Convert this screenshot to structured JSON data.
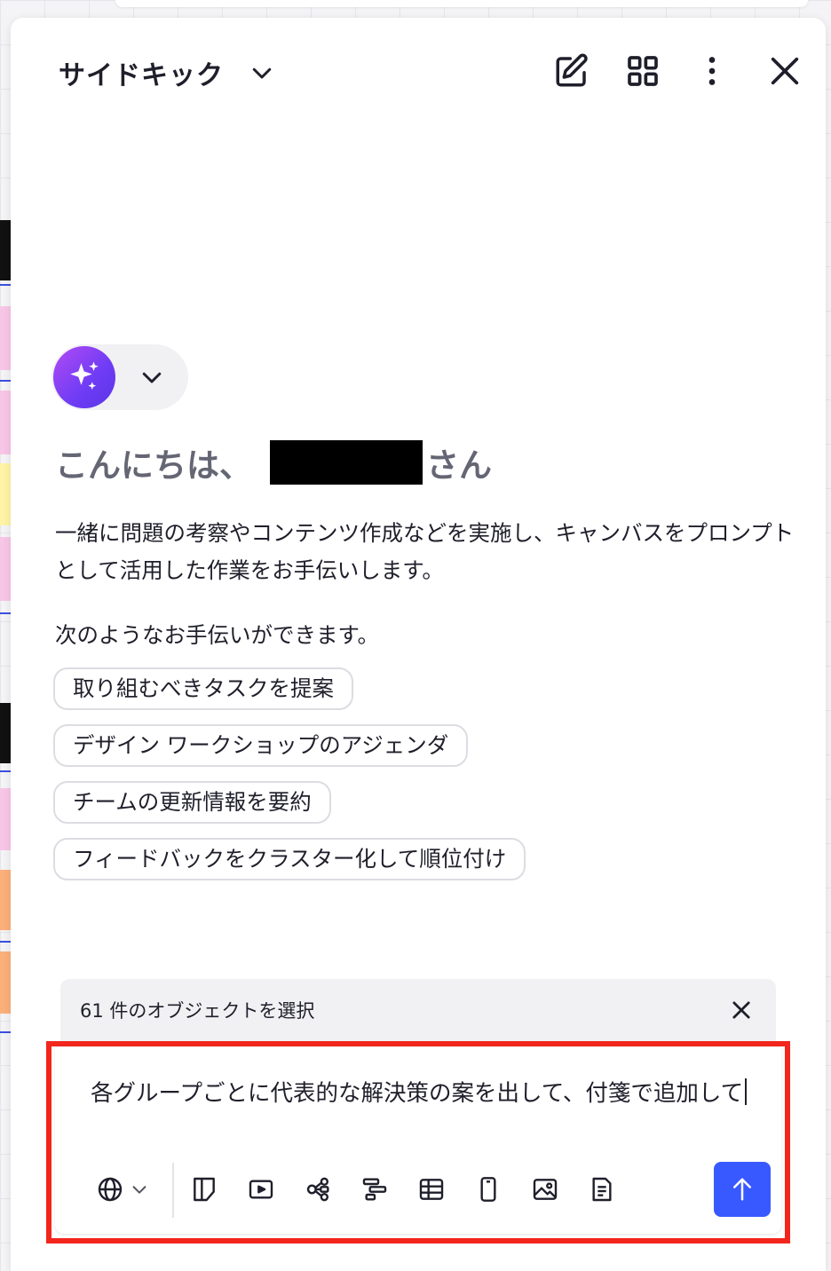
{
  "panel": {
    "title": "サイドキック"
  },
  "assistant": {
    "greeting_prefix": "こんにちは、",
    "greeting_suffix": "さん",
    "intro": "一緒に問題の考察やコンテンツ作成などを実施し、キャンバスをプロンプトとして活用した作業をお手伝いします。",
    "can_help": "次のようなお手伝いができます。",
    "suggestions": [
      "取り組むべきタスクを提案",
      "デザイン ワークショップのアジェンダ",
      "チームの更新情報を要約",
      "フィードバックをクラスター化して順位付け"
    ]
  },
  "selection": {
    "text": "61 件のオブジェクトを選択"
  },
  "composer": {
    "value": "各グループごとに代表的な解決策の案を出して、付箋で追加して"
  },
  "colors": {
    "accent": "#3859ff",
    "highlight_outline": "#f2261c",
    "assistant_gradient_start": "#b24bf3",
    "assistant_gradient_end": "#5b34e6"
  },
  "icons": {
    "header": [
      "new-chat-icon",
      "grid-icon",
      "more-vertical-icon",
      "close-icon"
    ],
    "toolbar": [
      "globe-icon",
      "sticky-note-icon",
      "slides-icon",
      "mind-map-icon",
      "timeline-icon",
      "table-icon",
      "mobile-frame-icon",
      "image-icon",
      "document-icon",
      "send-arrow-icon"
    ]
  }
}
